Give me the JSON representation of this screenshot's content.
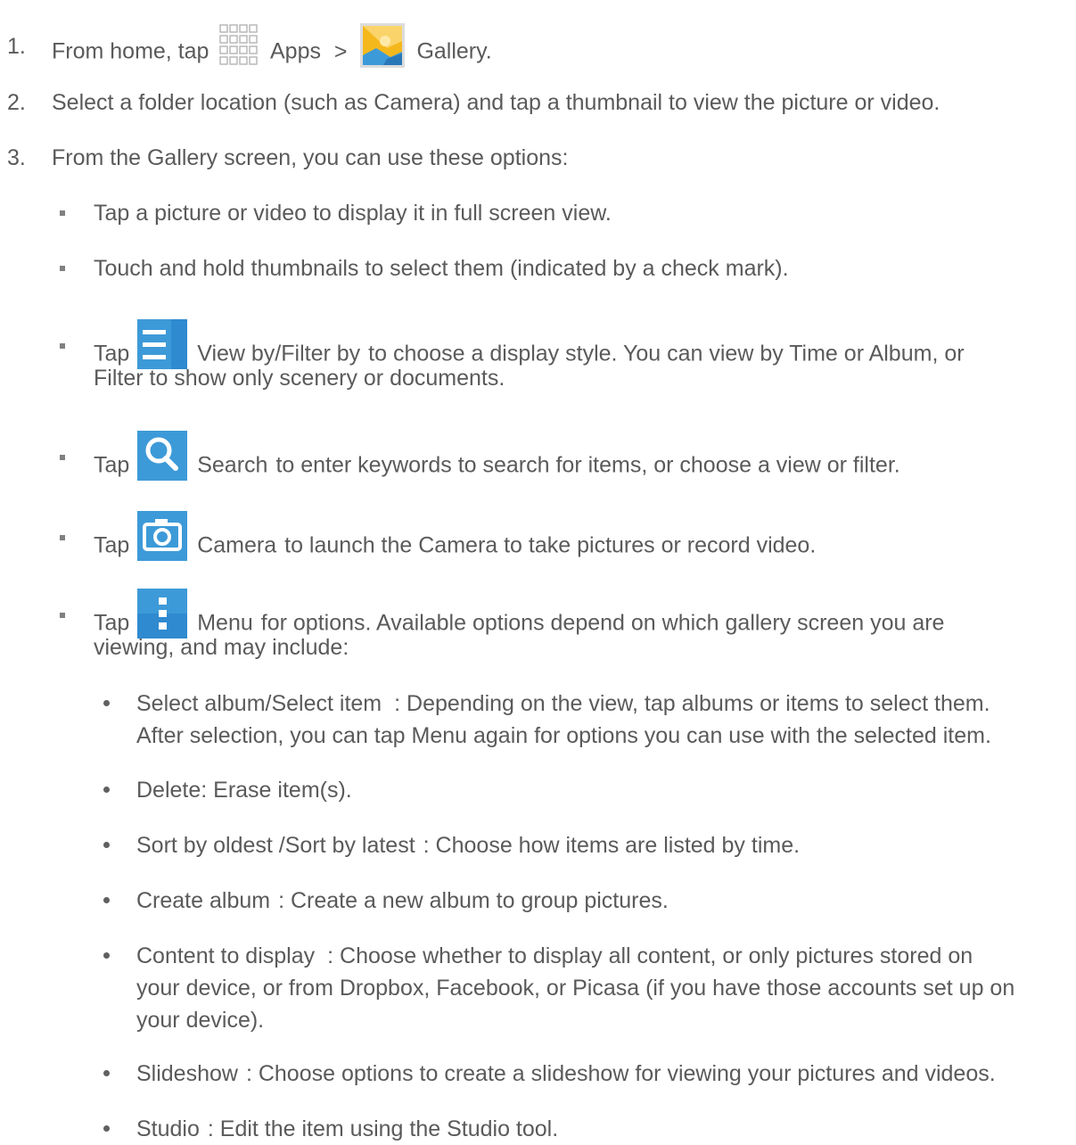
{
  "steps": [
    {
      "num": "1.",
      "pre": "From home, tap",
      "apps": "Apps",
      "sep": ">",
      "gallery": "Gallery",
      "end": "."
    },
    {
      "num": "2.",
      "text": "Select a folder location (such as Camera) and tap a thumbnail to view the picture or video."
    },
    {
      "num": "3.",
      "text": "From the Gallery screen, you can use these options:"
    }
  ],
  "bullets": [
    {
      "text": "Tap a picture or video to display it in full screen view."
    },
    {
      "text": "Touch and hold thumbnails to select them (indicated by a check mark)."
    },
    {
      "tap": "Tap",
      "name": "View by/Filter by",
      "text1": "to choose a display style. You can view by Time or Album, or",
      "text2": "Filter to show only scenery or documents."
    },
    {
      "tap": "Tap",
      "name": "Search",
      "text1": "to enter keywords to search for items, or choose a view or filter."
    },
    {
      "tap": "Tap",
      "name": "Camera",
      "text1": "to launch the Camera to take pictures or record video."
    },
    {
      "tap": "Tap",
      "name": "Menu",
      "text1": "for options. Available options depend on which gallery screen you are",
      "text2": "viewing, and may include:"
    }
  ],
  "options": [
    {
      "name": "Select album/Select item",
      "lines": [
        ": Depending on the view, tap albums or items to select them.",
        "After selection, you can tap Menu again for options you can use with the selected item."
      ]
    },
    {
      "name": "Delete",
      "lines": [
        ": Erase item(s)."
      ]
    },
    {
      "name": "Sort by oldest /Sort by latest",
      "lines": [
        ": Choose how items are listed by time."
      ]
    },
    {
      "name": "Create album",
      "lines": [
        ": Create a new album to group pictures."
      ]
    },
    {
      "name": "Content to display",
      "lines": [
        ": Choose whether to display all content, or only pictures stored on",
        "your device, or from Dropbox, Facebook, or Picasa (if you have those accounts set up on",
        "your device)."
      ]
    },
    {
      "name": "Slideshow",
      "lines": [
        ": Choose options to create a slideshow for viewing your pictures and videos."
      ]
    },
    {
      "name": "Studio",
      "lines": [
        ": Edit the item using the Studio tool."
      ]
    }
  ],
  "icons": {
    "apps": "apps-grid-icon",
    "gallery": "gallery-icon",
    "view": "list-view-icon",
    "search": "search-icon",
    "camera": "camera-icon",
    "menu": "menu-icon"
  },
  "colors": {
    "text": "#5a5a5a",
    "icon_blue": "#3d9ad8",
    "gallery_yellow": "#f5b81c"
  }
}
